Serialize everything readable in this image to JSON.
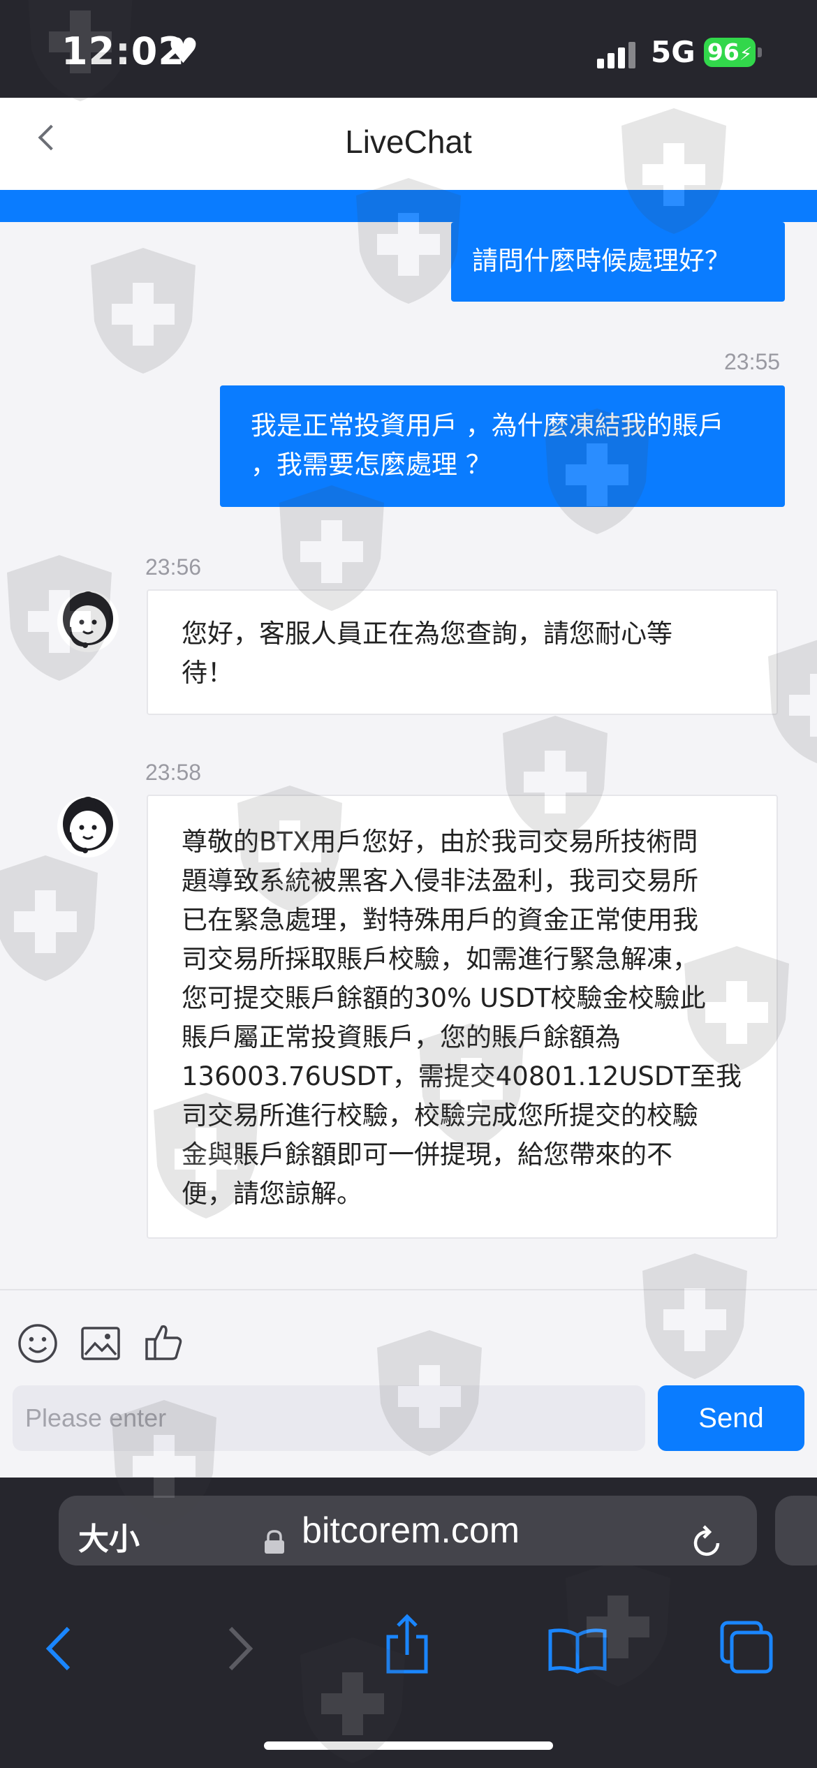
{
  "status_bar": {
    "time": "12:02",
    "heart": "♥",
    "network": "5G",
    "battery": "96"
  },
  "header": {
    "title": "LiveChat",
    "back_icon": "chevron-left-icon"
  },
  "messages": [
    {
      "dir": "out",
      "text": "請問什麼時候處理好？"
    },
    {
      "dir": "out",
      "time": "23:55",
      "text": "我是正常投資用戶 ，為什麼凍結我的賬戶\n，我需要怎麼處理 ？"
    },
    {
      "dir": "in",
      "time": "23:56",
      "text": "您好，客服人員正在為您查詢，請您耐心等\n待！"
    },
    {
      "dir": "in",
      "time": "23:58",
      "text": "尊敬的BTX用戶您好，由於我司交易所技術問\n題導致系統被黑客入侵非法盈利，我司交易所\n已在緊急處理，對特殊用戶的資金正常使用我\n司交易所採取賬戶校驗，如需進行緊急解凍，\n您可提交賬戶餘額的30% USDT校驗金校驗此\n賬戶屬正常投資賬戶，您的賬戶餘額為\n136003.76USDT，需提交40801.12USDT至我\n司交易所進行校驗，校驗完成您所提交的校驗\n金與賬戶餘額即可一併提現，給您帶來的不\n便，請您諒解。"
    }
  ],
  "composer": {
    "placeholder": "Please enter",
    "value": "",
    "send_label": "Send",
    "tools": [
      "emoji-icon",
      "image-icon",
      "thumbs-up-icon"
    ]
  },
  "browser": {
    "text_size_label": "大小",
    "url": "bitcorem.com",
    "nav": [
      "back-arrow-icon",
      "forward-arrow-icon",
      "share-icon",
      "bookmarks-icon",
      "tabs-icon"
    ]
  },
  "colors": {
    "accent": "#0a7cff",
    "status_bar_bg": "#26262d",
    "battery": "#32d74b"
  }
}
